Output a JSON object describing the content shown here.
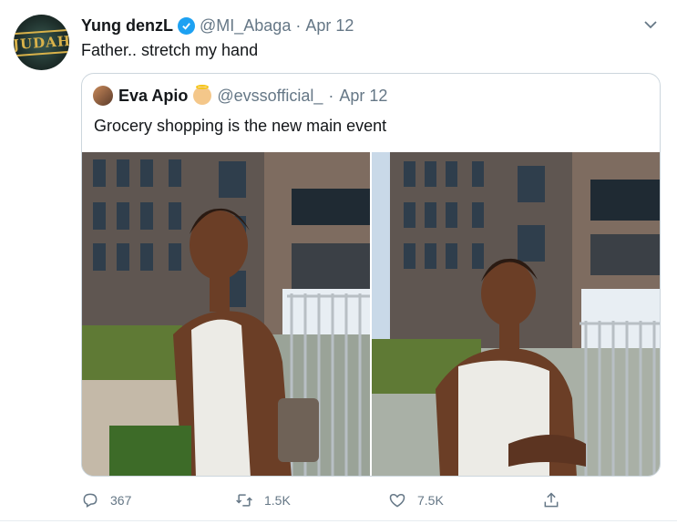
{
  "tweet": {
    "avatar_text": "JUDAH",
    "display_name": "Yung denzL",
    "handle": "@MI_Abaga",
    "separator": "·",
    "date": "Apr 12",
    "text": "Father.. stretch my hand"
  },
  "quoted_tweet": {
    "display_name": "Eva Apio",
    "handle": "@evssofficial_",
    "separator": "·",
    "date": "Apr 12",
    "text": "Grocery shopping is the new main event",
    "photo_count": 2
  },
  "actions": {
    "replies": "367",
    "retweets": "1.5K",
    "likes": "7.5K"
  },
  "colors": {
    "accent": "#1da1f2",
    "muted": "#657786",
    "border": "#ccd6dd"
  },
  "icons": [
    "verified-badge-icon",
    "chevron-down-icon",
    "reply-icon",
    "retweet-icon",
    "like-icon",
    "share-icon",
    "angel-emoji-icon"
  ]
}
